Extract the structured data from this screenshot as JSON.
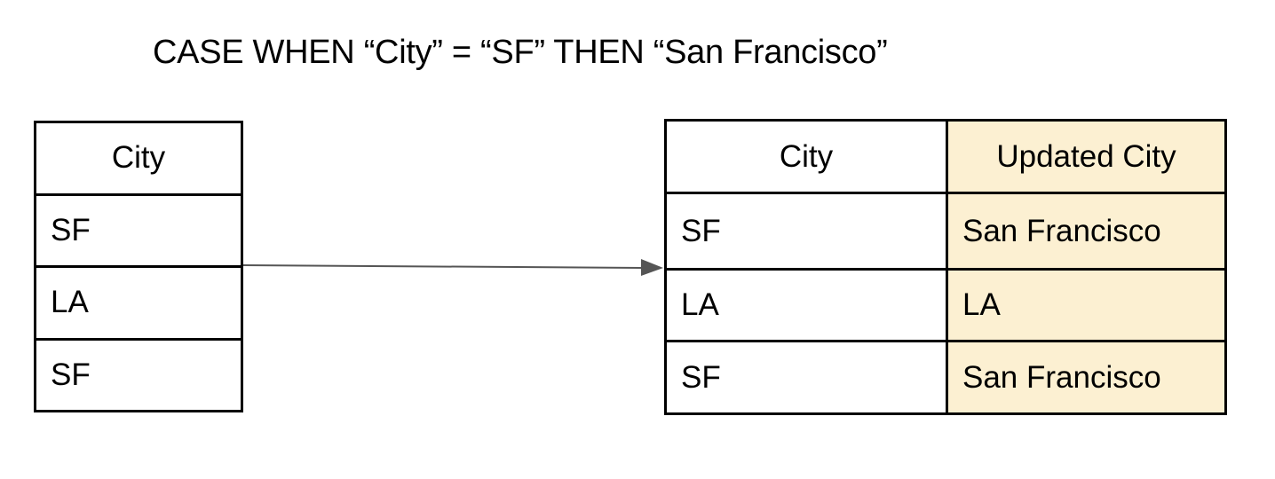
{
  "title": "CASE WHEN “City” = “SF” THEN “San Francisco”",
  "source_table": {
    "header": "City",
    "rows": [
      "SF",
      "LA",
      "SF"
    ]
  },
  "result_table": {
    "headers": [
      "City",
      "Updated City"
    ],
    "rows": [
      [
        "SF",
        "San Francisco"
      ],
      [
        "LA",
        "LA"
      ],
      [
        "SF",
        "San Francisco"
      ]
    ]
  },
  "colors": {
    "highlight_fill": "#fcf0d2",
    "arrow": "#555555",
    "border": "#000000"
  },
  "arrow": {
    "from": "source_table",
    "to": "result_table"
  }
}
